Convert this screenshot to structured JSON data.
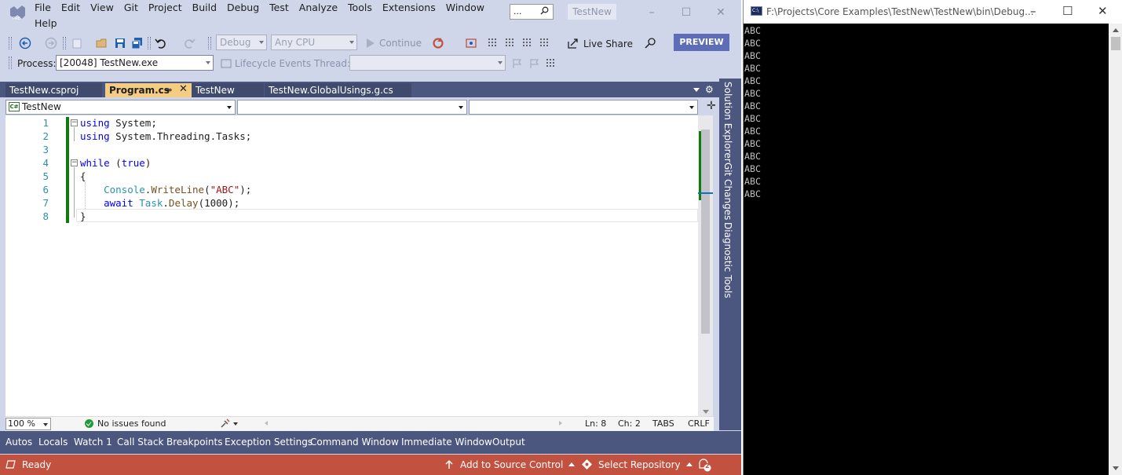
{
  "vs": {
    "menu": [
      "File",
      "Edit",
      "View",
      "Git",
      "Project",
      "Build",
      "Debug",
      "Test",
      "Analyze",
      "Tools",
      "Extensions",
      "Window"
    ],
    "menu_help": "Help",
    "search_text": "...",
    "solution_name": "TestNew",
    "toolbar": {
      "config": "Debug",
      "platform": "Any CPU",
      "continue_label": "Continue",
      "live_share": "Live Share",
      "preview": "PREVIEW",
      "process_label": "Process:",
      "process_value": "[20048] TestNew.exe",
      "lifecycle": "Lifecycle Events",
      "thread_label": "Thread:"
    },
    "doc_tabs": [
      "TestNew.csproj",
      "Program.cs",
      "TestNew",
      "TestNew.GlobalUsings.g.cs"
    ],
    "pin_glyph": "⊸",
    "close_glyph": "✕",
    "nav": {
      "project": "TestNew",
      "cs_badge": "C#"
    },
    "code": {
      "line_numbers": [
        "1",
        "2",
        "3",
        "4",
        "5",
        "6",
        "7",
        "8"
      ],
      "l1_kw": "using",
      "l1_rest": " System;",
      "l2_kw": "using",
      "l2_rest": " System.Threading.Tasks;",
      "l4_kw": "while",
      "l4_p1": " (",
      "l4_kw2": "true",
      "l4_p2": ")",
      "l5": "{",
      "l6_indent": "    ",
      "l6_cls": "Console",
      "l6_dot": ".",
      "l6_m": "WriteLine",
      "l6_p1": "(",
      "l6_str": "\"ABC\"",
      "l6_p2": ");",
      "l7_indent": "    ",
      "l7_kw": "await",
      "l7_sp": " ",
      "l7_cls": "Task",
      "l7_dot": ".",
      "l7_m": "Delay",
      "l7_args": "(1000);",
      "l8": "}"
    },
    "editor_status": {
      "zoom": "100 %",
      "issues": "No issues found",
      "ln": "Ln: 8",
      "ch": "Ch: 2",
      "tabs": "TABS",
      "eol": "CRLF"
    },
    "side_tabs": [
      "Solution Explorer",
      "Git Changes",
      "Diagnostic Tools"
    ],
    "tool_tabs": [
      "Autos",
      "Locals",
      "Watch 1",
      "Call Stack",
      "Breakpoints",
      "Exception Settings",
      "Command Window",
      "Immediate Window",
      "Output"
    ],
    "statusbar": {
      "ready": "Ready",
      "source_control": "Add to Source Control",
      "repository": "Select Repository",
      "notifications": "2"
    },
    "colors": {
      "accent": "#5d6db8",
      "status_debug": "#c2513f",
      "tab_active": "#f5cc84",
      "frame": "#4b577f"
    }
  },
  "console": {
    "title": "F:\\Projects\\Core Examples\\TestNew\\TestNew\\bin\\Debug...",
    "icon_text": "C:\\",
    "output_lines": [
      "ABC",
      "ABC",
      "ABC",
      "ABC",
      "ABC",
      "ABC",
      "ABC",
      "ABC",
      "ABC",
      "ABC",
      "ABC",
      "ABC",
      "ABC",
      "ABC"
    ]
  }
}
